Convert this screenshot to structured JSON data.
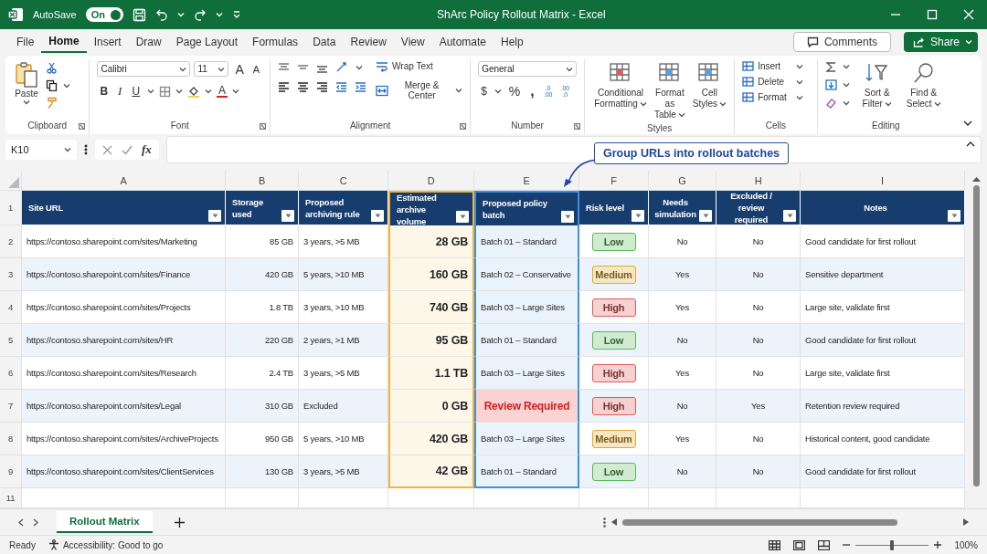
{
  "title_bar": {
    "autosave_label": "AutoSave",
    "autosave": {
      "label": "On",
      "on": true
    },
    "title": "ShArc Policy Rollout Matrix - Excel"
  },
  "menu_tabs": [
    {
      "label": "File",
      "selected": false
    },
    {
      "label": "Home",
      "selected": true
    },
    {
      "label": "Insert",
      "selected": false
    },
    {
      "label": "Draw",
      "selected": false
    },
    {
      "label": "Page Layout",
      "selected": false
    },
    {
      "label": "Formulas",
      "selected": false
    },
    {
      "label": "Data",
      "selected": false
    },
    {
      "label": "Review",
      "selected": false
    },
    {
      "label": "View",
      "selected": false
    },
    {
      "label": "Automate",
      "selected": false
    },
    {
      "label": "Help",
      "selected": false
    }
  ],
  "comments_button": "Comments",
  "share_button": "Share",
  "ribbon": {
    "clipboard": {
      "paste": "Paste",
      "label": "Clipboard"
    },
    "font": {
      "name": "Calibri",
      "size": "11",
      "grow": "A",
      "shrink": "A",
      "bold": "B",
      "italic": "I",
      "underline": "U",
      "font_color": "A",
      "label": "Font"
    },
    "alignment": {
      "wrap_text": "Wrap Text",
      "merge_center": "Merge & Center",
      "label": "Alignment"
    },
    "number": {
      "format": "General",
      "currency": "$",
      "percent": "%",
      "comma": ",",
      "decimals": [
        [
          ".0",
          ".00"
        ],
        [
          ".00",
          ".0"
        ]
      ],
      "label": "Number"
    },
    "styles": {
      "buttons": [
        [
          "Conditional",
          "Formatting"
        ],
        [
          "Format as",
          "Table"
        ],
        [
          "Cell",
          "Styles"
        ]
      ],
      "label": "Styles"
    },
    "cells": {
      "buttons": [
        "Insert",
        "Delete",
        "Format"
      ],
      "label": "Cells"
    },
    "editing": {
      "buttons": [
        [
          "Sort &",
          "Filter"
        ],
        [
          "Find &",
          "Select"
        ]
      ],
      "label": "Editing"
    }
  },
  "formula_bar": {
    "name_box": "K10",
    "fx": "fx"
  },
  "callout": "Group URLs into rollout batches",
  "sheet": {
    "column_letters": [
      "A",
      "B",
      "C",
      "D",
      "E",
      "F",
      "G",
      "H",
      "I"
    ],
    "header_row_number": "1",
    "columns": [
      {
        "title": "Site URL"
      },
      {
        "title": "Storage used"
      },
      {
        "title": "Proposed archiving rule"
      },
      {
        "title": "Estimated archive volume",
        "color": "#f0b43c"
      },
      {
        "title": "Proposed policy batch",
        "color": "#3d8fe0"
      },
      {
        "title": "Risk level"
      },
      {
        "title": "Needs simulation"
      },
      {
        "title": "Excluded / review required"
      },
      {
        "title": "Notes"
      }
    ],
    "rows": [
      {
        "number": "2",
        "url": "https://contoso.sharepoint.com/sites/Marketing",
        "storage": "85 GB",
        "rule": "3 years, >5 MB",
        "volume": "28 GB",
        "batch": "Batch 01 – Standard",
        "batch_alert": false,
        "risk": {
          "label": "Low",
          "color": "#5cb85c"
        },
        "simulation": "No",
        "excluded": "No",
        "notes": "Good candidate for first rollout"
      },
      {
        "number": "3",
        "url": "https://contoso.sharepoint.com/sites/Finance",
        "storage": "420 GB",
        "rule": "5 years, >10 MB",
        "volume": "160 GB",
        "batch": "Batch 02 – Conservative",
        "batch_alert": false,
        "risk": {
          "label": "Medium",
          "color": "#e0a82e"
        },
        "simulation": "Yes",
        "excluded": "No",
        "notes": "Sensitive department"
      },
      {
        "number": "4",
        "url": "https://contoso.sharepoint.com/sites/Projects",
        "storage": "1.8 TB",
        "rule": "3 years, >10 MB",
        "volume": "740 GB",
        "batch": "Batch 03 – Large Sites",
        "batch_alert": false,
        "risk": {
          "label": "High",
          "color": "#e05a5a"
        },
        "simulation": "Yes",
        "excluded": "No",
        "notes": "Large site, validate first"
      },
      {
        "number": "5",
        "url": "https://contoso.sharepoint.com/sites/HR",
        "storage": "220 GB",
        "rule": "2 years, >1 MB",
        "volume": "95 GB",
        "batch": "Batch 01 – Standard",
        "batch_alert": false,
        "risk": {
          "label": "Low",
          "color": "#5cb85c"
        },
        "simulation": "No",
        "excluded": "No",
        "notes": "Good candidate for first rollout"
      },
      {
        "number": "6",
        "url": "https://contoso.sharepoint.com/sites/Research",
        "storage": "2.4 TB",
        "rule": "3 years, >5 MB",
        "volume": "1.1 TB",
        "batch": "Batch 03 – Large Sites",
        "batch_alert": false,
        "risk": {
          "label": "High",
          "color": "#e05a5a"
        },
        "simulation": "Yes",
        "excluded": "No",
        "notes": "Large site, validate first"
      },
      {
        "number": "7",
        "url": "https://contoso.sharepoint.com/sites/Legal",
        "storage": "310 GB",
        "rule": "Excluded",
        "volume": "0 GB",
        "batch": "Review Required",
        "batch_alert": true,
        "risk": {
          "label": "High",
          "color": "#e05a5a"
        },
        "simulation": "No",
        "excluded": "Yes",
        "notes": "Retention review required"
      },
      {
        "number": "8",
        "url": "https://contoso.sharepoint.com/sites/ArchiveProjects",
        "storage": "950 GB",
        "rule": "5 years, >10 MB",
        "volume": "420 GB",
        "batch": "Batch 03 – Large Sites",
        "batch_alert": false,
        "risk": {
          "label": "Medium",
          "color": "#e0a82e"
        },
        "simulation": "Yes",
        "excluded": "No",
        "notes": "Historical content, good candidate"
      },
      {
        "number": "9",
        "url": "https://contoso.sharepoint.com/sites/ClientServices",
        "storage": "130 GB",
        "rule": "3 years, >5 MB",
        "volume": "42 GB",
        "batch": "Batch 01 – Standard",
        "batch_alert": false,
        "risk": {
          "label": "Low",
          "color": "#5cb85c"
        },
        "simulation": "No",
        "excluded": "No",
        "notes": "Good candidate for first rollout"
      }
    ],
    "empty_rows": [
      "11"
    ]
  },
  "sheet_tabs": [
    {
      "label": "Rollout Matrix",
      "selected": true
    }
  ],
  "status_bar": {
    "ready": "Ready",
    "accessibility": "Accessibility: Good to go",
    "zoom": {
      "level": 0.5
    },
    "zoom_label": "100%"
  }
}
